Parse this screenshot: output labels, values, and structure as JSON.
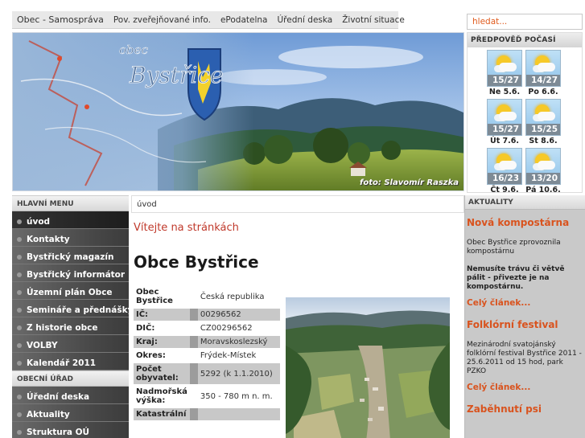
{
  "topnav": {
    "items": [
      "Obec - Samospráva",
      "Pov. zveřejňované info.",
      "ePodatelna",
      "Úřední deska",
      "Životní situace"
    ]
  },
  "search": {
    "placeholder": "hledat..."
  },
  "banner": {
    "logo_top": "obec",
    "logo_name": "Bystřice",
    "photo_credit": "foto: Slavomír Raszka"
  },
  "weather": {
    "title": "PŘEDPOVĚĎ POČASÍ",
    "icon": "partly-cloudy-icon",
    "days": [
      {
        "temp": "15/27",
        "day": "Ne 5.6."
      },
      {
        "temp": "14/27",
        "day": "Po 6.6."
      },
      {
        "temp": "15/27",
        "day": "Út 7.6."
      },
      {
        "temp": "15/25",
        "day": "St 8.6."
      },
      {
        "temp": "16/23",
        "day": "Čt 9.6."
      },
      {
        "temp": "13/20",
        "day": "Pá 10.6."
      }
    ]
  },
  "leftmenu": {
    "main_heading": "HLAVNÍ MENU",
    "main_items": [
      "úvod",
      "Kontakty",
      "Bystřický magazín",
      "Bystřický informátor",
      "Územní plán Obce",
      "Semináře a přednášky",
      "Z historie obce",
      "VOLBY",
      "Kalendář 2011"
    ],
    "office_heading": "OBECNÍ ÚŘAD",
    "office_items": [
      "Úřední deska",
      "Aktuality",
      "Struktura OÚ"
    ]
  },
  "breadcrumb": "úvod",
  "main": {
    "welcome": "Vítejte na stránkách",
    "heading": "Obce Bystřice",
    "info": [
      {
        "label": "Obec Bystřice",
        "value": "Česká republika",
        "shaded": false
      },
      {
        "label": "IČ:",
        "value": "00296562",
        "shaded": true
      },
      {
        "label": "DIČ:",
        "value": "CZ00296562",
        "shaded": false
      },
      {
        "label": "Kraj:",
        "value": "Moravskoslezský",
        "shaded": true
      },
      {
        "label": "Okres:",
        "value": "Frýdek-Místek",
        "shaded": false
      },
      {
        "label": "Počet obyvatel:",
        "value": "5292 (k 1.1.2010)",
        "shaded": true
      },
      {
        "label": "Nadmořská výška:",
        "value": "350 - 780 m n. m.",
        "shaded": false
      },
      {
        "label": "Katastrální",
        "value": "",
        "shaded": true
      }
    ]
  },
  "news": {
    "heading": "AKTUALITY",
    "items": [
      {
        "title": "Nová kompostárna",
        "text": "Obec Bystřice zprovoznila kompostárnu",
        "bold": "Nemusíte trávu či větvě pálit - přivezte je na kompostárnu.",
        "link": "Celý článek..."
      },
      {
        "title": "Folklórní festival",
        "text": "Mezinárodní svatojánský folklórní festival Bystřice 2011 - 25.6.2011 od 15 hod, park PZKO",
        "bold": "",
        "link": "Celý článek..."
      },
      {
        "title": "Zaběhnutí psi",
        "text": "",
        "bold": "",
        "link": ""
      }
    ]
  }
}
